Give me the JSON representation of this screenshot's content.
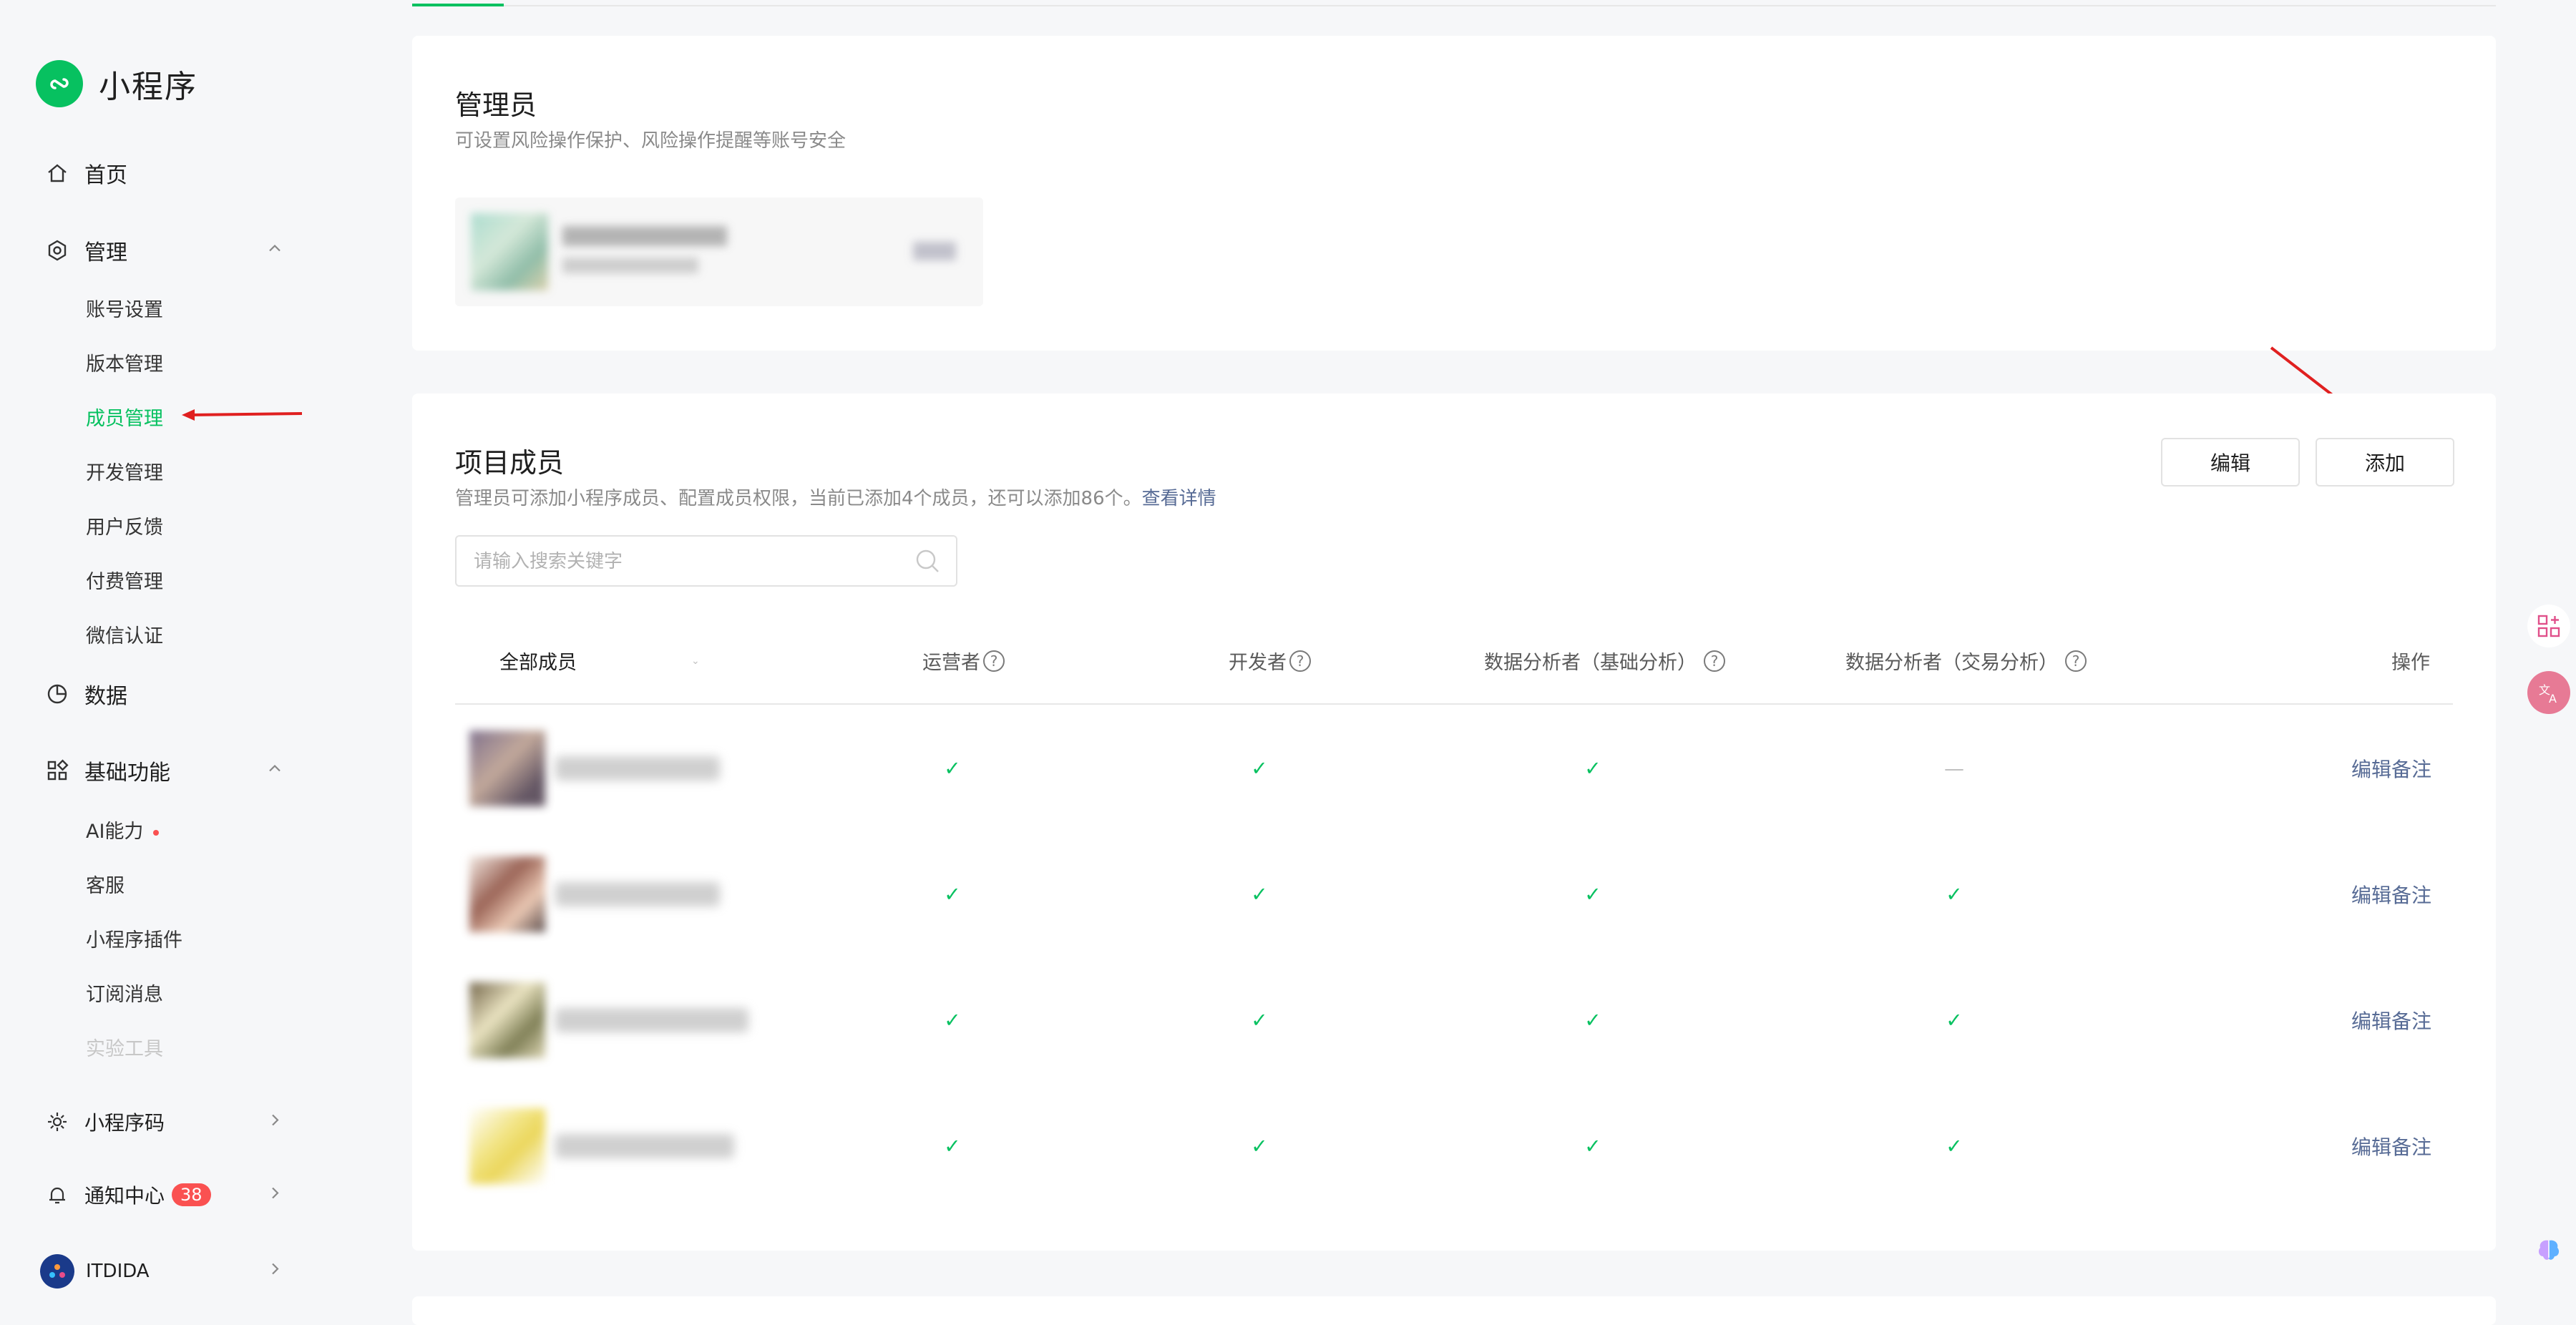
{
  "brand": {
    "name": "小程序",
    "color": "#07c160"
  },
  "sidebar": {
    "home": "首页",
    "manage": {
      "label": "管理",
      "items": [
        "账号设置",
        "版本管理",
        "成员管理",
        "开发管理",
        "用户反馈",
        "付费管理",
        "微信认证"
      ]
    },
    "data": "数据",
    "basic": {
      "label": "基础功能",
      "items": [
        "AI能力",
        "客服",
        "小程序插件",
        "订阅消息",
        "实验工具"
      ]
    },
    "qrcode": "小程序码",
    "notify": {
      "label": "通知中心",
      "count": "38"
    },
    "account": "ITDIDA"
  },
  "admin_card": {
    "title": "管理员",
    "desc": "可设置风险操作保护、风险操作提醒等账号安全"
  },
  "members_card": {
    "title": "项目成员",
    "desc": "管理员可添加小程序成员、配置成员权限，当前已添加4个成员，还可以添加86个。",
    "detail_link": "查看详情",
    "edit_button": "编辑",
    "add_button": "添加",
    "search_placeholder": "请输入搜索关键字",
    "columns": {
      "all": "全部成员",
      "operator": "运营者",
      "developer": "开发者",
      "analyst_basic": "数据分析者（基础分析）",
      "analyst_trade": "数据分析者（交易分析）",
      "action": "操作"
    },
    "check": "✓",
    "dash": "—",
    "rows": [
      {
        "operator": true,
        "developer": true,
        "analyst_basic": true,
        "analyst_trade": false,
        "action": "编辑备注"
      },
      {
        "operator": true,
        "developer": true,
        "analyst_basic": true,
        "analyst_trade": true,
        "action": "编辑备注"
      },
      {
        "operator": true,
        "developer": true,
        "analyst_basic": true,
        "analyst_trade": true,
        "action": "编辑备注"
      },
      {
        "operator": true,
        "developer": true,
        "analyst_basic": true,
        "analyst_trade": true,
        "action": "编辑备注"
      }
    ]
  },
  "colors": {
    "accent": "#07c160",
    "link": "#576b95",
    "badge": "#fa5151",
    "annotation_arrow": "#e02020"
  }
}
